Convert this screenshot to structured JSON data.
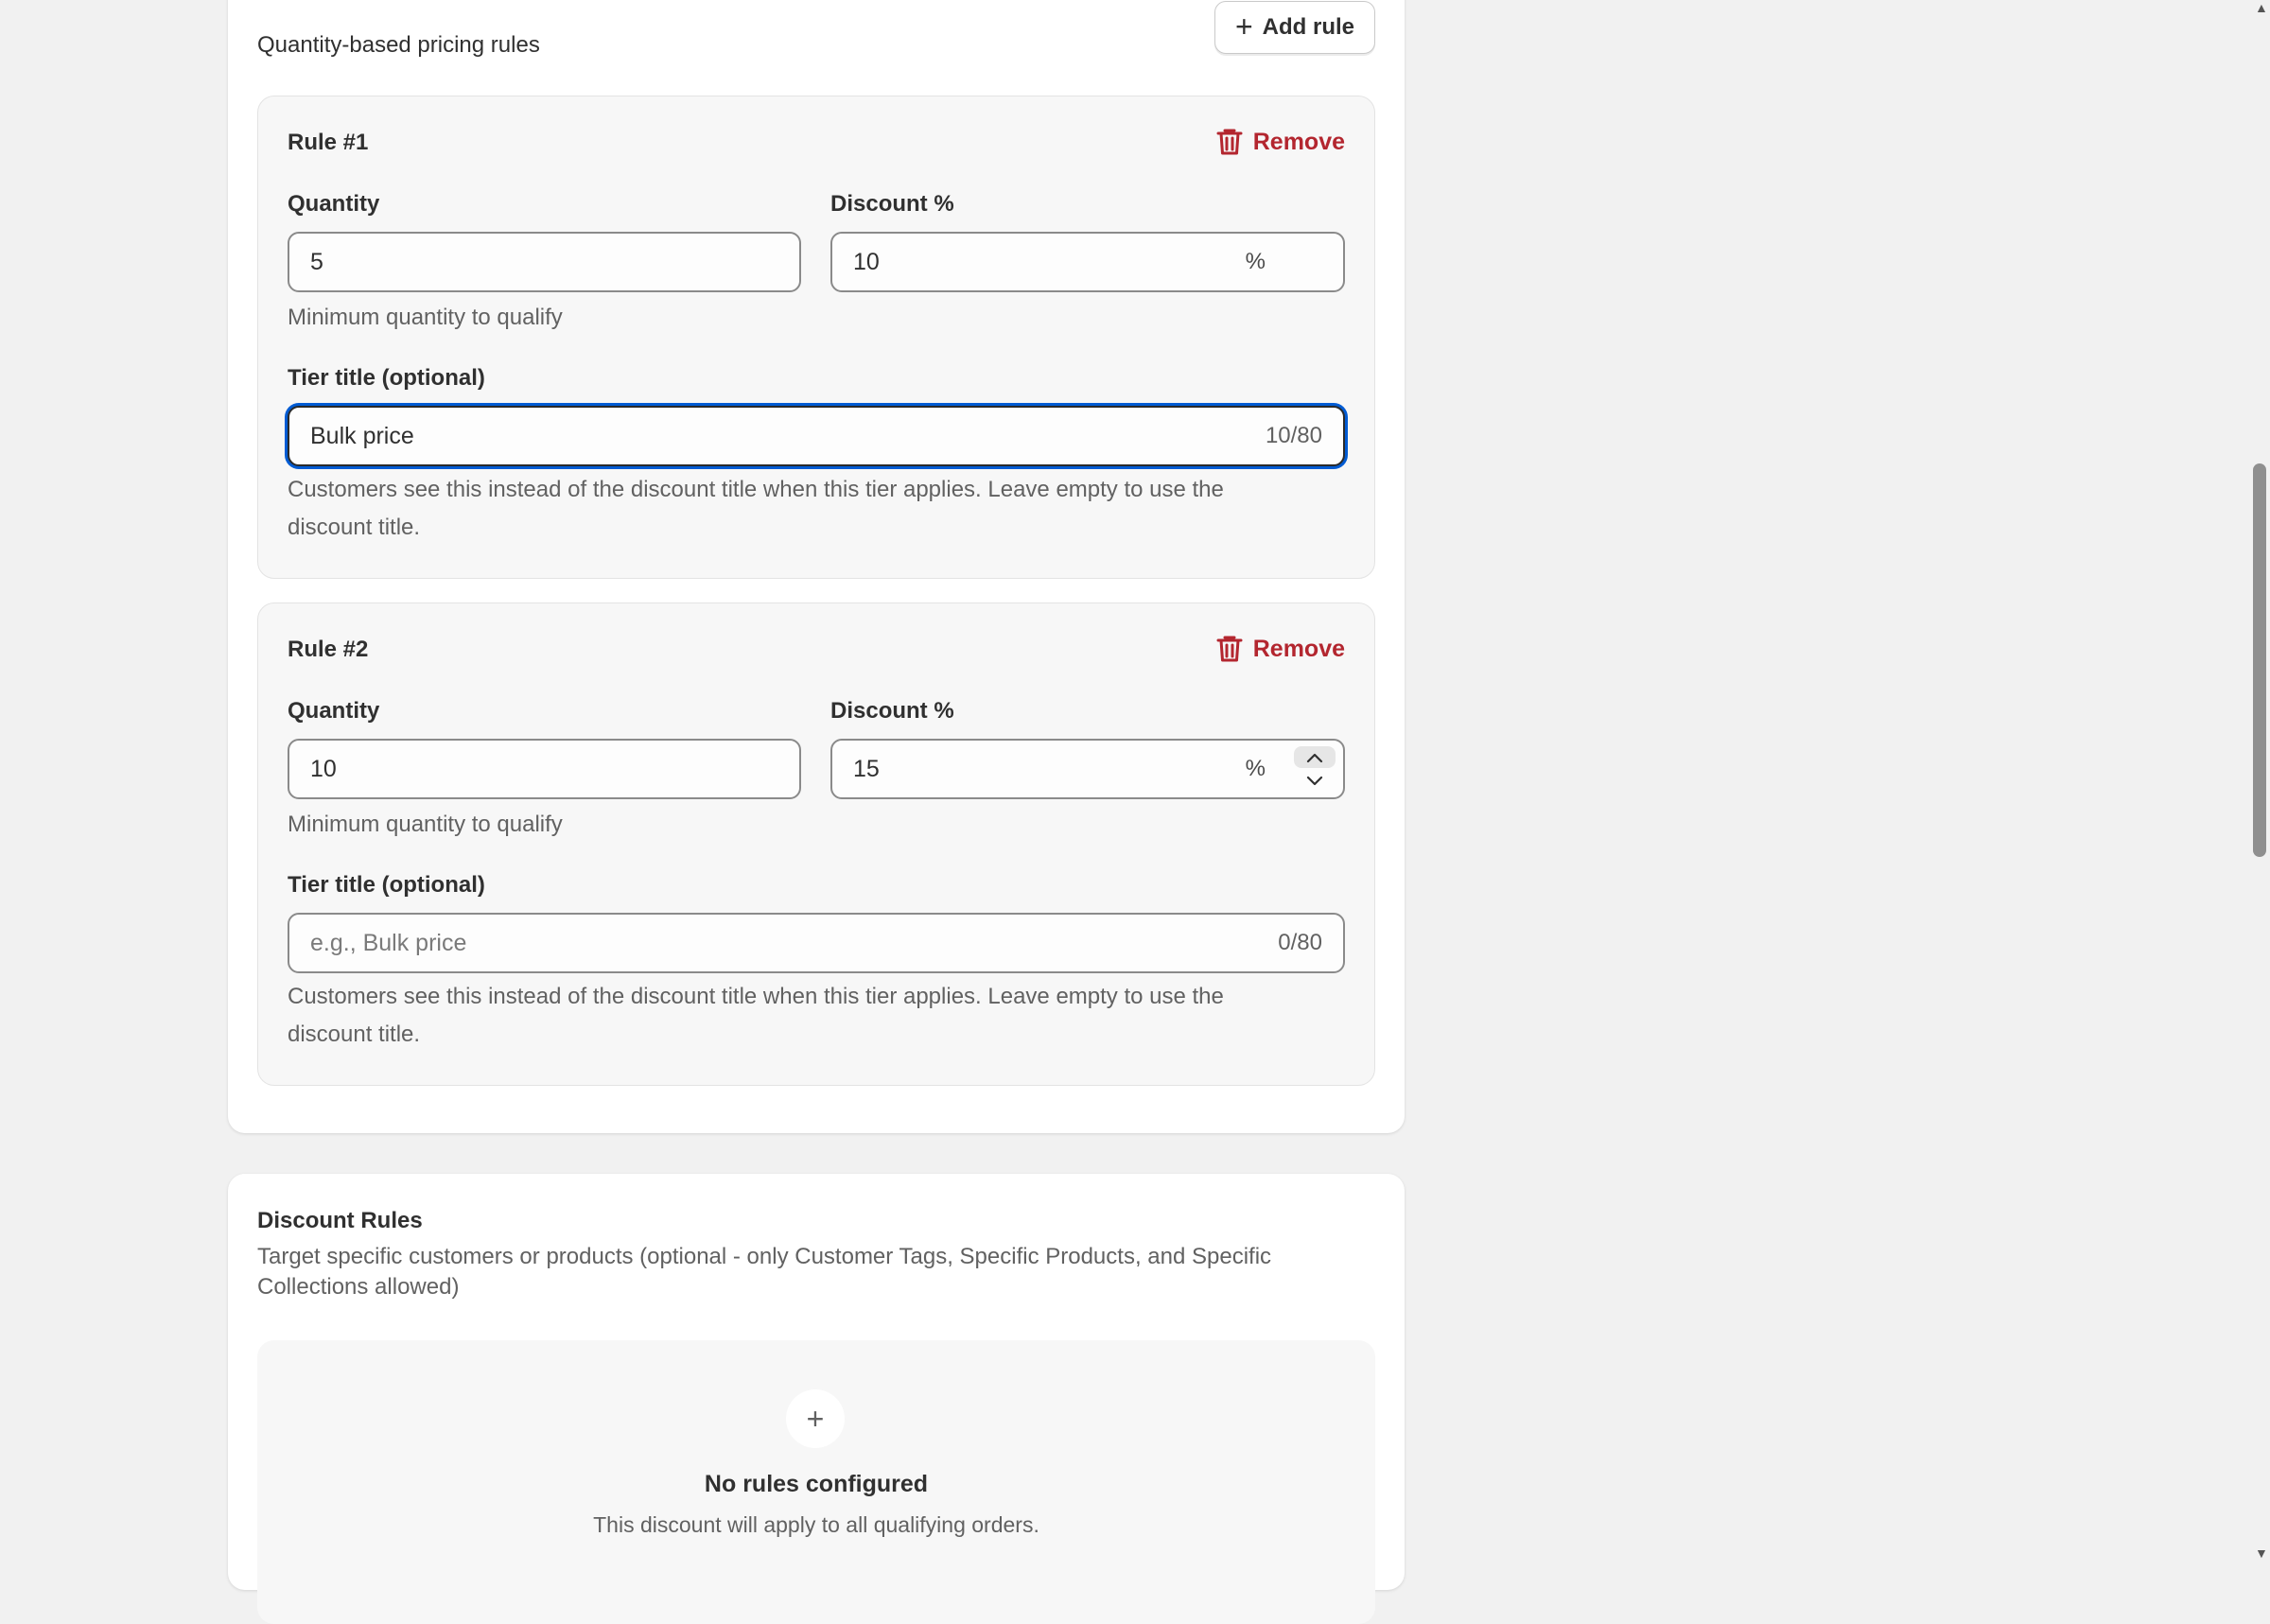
{
  "pricing": {
    "title": "Quantity-based pricing rules",
    "add_rule_label": "Add rule",
    "rules": [
      {
        "title": "Rule #1",
        "remove_label": "Remove",
        "quantity_label": "Quantity",
        "quantity_value": "5",
        "quantity_help": "Minimum quantity to qualify",
        "discount_label": "Discount %",
        "discount_value": "10",
        "discount_suffix": "%",
        "tier_label": "Tier title (optional)",
        "tier_value": "Bulk price",
        "tier_placeholder": "",
        "tier_counter": "10/80",
        "tier_help_line1": "Customers see this instead of the discount title when this tier applies. Leave empty to use the",
        "tier_help_line2": "discount title."
      },
      {
        "title": "Rule #2",
        "remove_label": "Remove",
        "quantity_label": "Quantity",
        "quantity_value": "10",
        "quantity_help": "Minimum quantity to qualify",
        "discount_label": "Discount %",
        "discount_value": "15",
        "discount_suffix": "%",
        "tier_label": "Tier title (optional)",
        "tier_value": "",
        "tier_placeholder": "e.g., Bulk price",
        "tier_counter": "0/80",
        "tier_help_line1": "Customers see this instead of the discount title when this tier applies. Leave empty to use the",
        "tier_help_line2": "discount title."
      }
    ]
  },
  "discount_rules": {
    "title": "Discount Rules",
    "description_line1": "Target specific customers or products (optional - only Customer Tags, Specific Products, and Specific",
    "description_line2": "Collections allowed)",
    "empty_title": "No rules configured",
    "empty_subtitle": "This discount will apply to all qualifying orders.",
    "add_icon": "+"
  },
  "colors": {
    "danger": "#b3262f",
    "focus": "#005bd3",
    "background": "#f1f1f1"
  }
}
